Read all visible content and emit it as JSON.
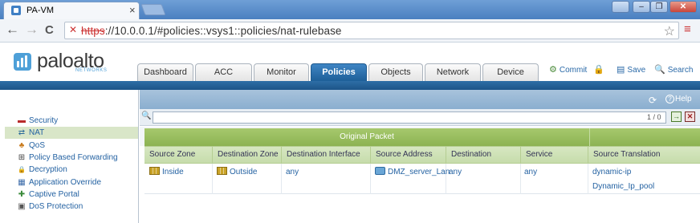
{
  "browser": {
    "tab_title": "PA-VM",
    "tab_close": "×",
    "url_scheme": "https",
    "url_rest": "://10.0.0.1/#policies::vsys1::policies/nat-rulebase",
    "back": "←",
    "forward": "→",
    "reload": "C",
    "star": "☆",
    "menu": "≡",
    "win_user": "👤",
    "win_min": "–",
    "win_max": "❐",
    "win_close": "✕"
  },
  "brand": {
    "logo_text": "paloalto",
    "logo_sub": "NETWORKS",
    "accent": "#1e5f98"
  },
  "nav": {
    "tabs": [
      {
        "label": "Dashboard"
      },
      {
        "label": "ACC"
      },
      {
        "label": "Monitor"
      },
      {
        "label": "Policies"
      },
      {
        "label": "Objects"
      },
      {
        "label": "Network"
      },
      {
        "label": "Device"
      }
    ],
    "active_tab": "Policies"
  },
  "header_actions": {
    "commit": "Commit",
    "save": "Save",
    "search": "Search"
  },
  "toolbar": {
    "help": "Help",
    "help_q": "?",
    "refresh_icon": "⟳"
  },
  "sidebar": {
    "items": [
      {
        "label": "Security",
        "icon": "shield-icon",
        "glyph": "▬"
      },
      {
        "label": "NAT",
        "icon": "nat-icon",
        "glyph": "⇄"
      },
      {
        "label": "QoS",
        "icon": "qos-icon",
        "glyph": "♣"
      },
      {
        "label": "Policy Based Forwarding",
        "icon": "forwarding-icon",
        "glyph": "⊞"
      },
      {
        "label": "Decryption",
        "icon": "lock-icon",
        "glyph": "🔒"
      },
      {
        "label": "Application Override",
        "icon": "app-override-icon",
        "glyph": "▦"
      },
      {
        "label": "Captive Portal",
        "icon": "portal-icon",
        "glyph": "✚"
      },
      {
        "label": "DoS Protection",
        "icon": "dos-icon",
        "glyph": "▣"
      }
    ],
    "active_item": "NAT"
  },
  "filter": {
    "count": "1 / 0",
    "apply_icon": "→",
    "clear_icon": "✕"
  },
  "table": {
    "group_header": "Original Packet",
    "columns": [
      "Source Zone",
      "Destination Zone",
      "Destination Interface",
      "Source Address",
      "Destination Address",
      "Service",
      "Source Translation"
    ],
    "rows": [
      {
        "source_zone": "Inside",
        "destination_zone": "Outside",
        "destination_interface": "any",
        "source_address": "DMZ_server_Lan",
        "destination_address": "any",
        "service": "any",
        "source_translation": "dynamic-ip",
        "source_translation_pool": "Dynamic_Ip_pool"
      }
    ]
  }
}
